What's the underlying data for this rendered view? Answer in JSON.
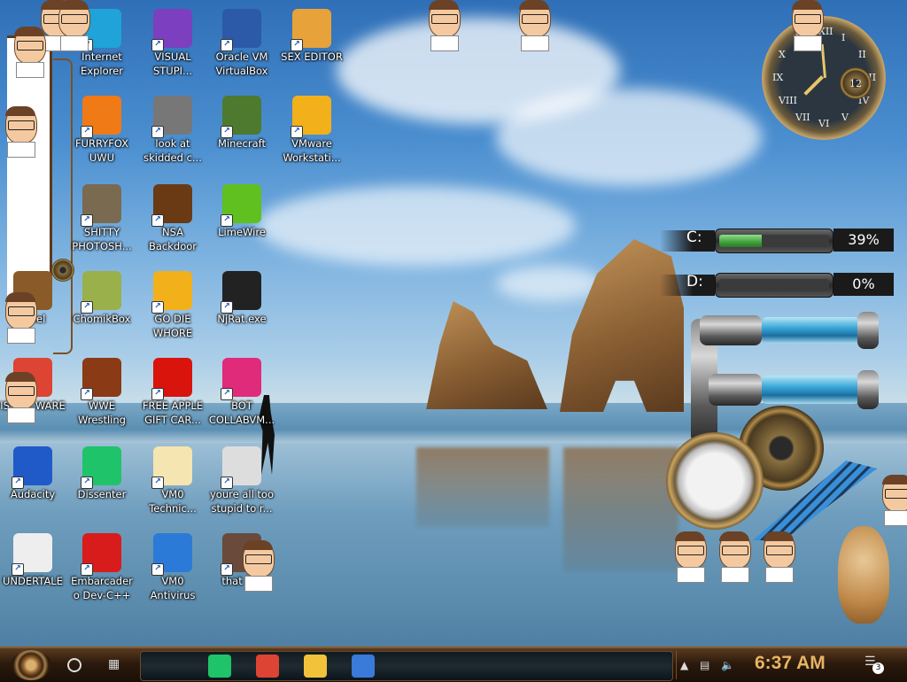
{
  "desktop": {
    "icons": [
      {
        "label": "Internet Explorer",
        "icon": "edge-icon",
        "color": "#1fa3d8"
      },
      {
        "label": "VISUAL STUPI...",
        "icon": "visual-studio-icon",
        "color": "#7b3fbf"
      },
      {
        "label": "Oracle VM VirtualBox",
        "icon": "virtualbox-icon",
        "color": "#2c5aa8"
      },
      {
        "label": "SEX EDITOR",
        "icon": "hex-editor-icon",
        "color": "#e8a23a"
      },
      {
        "label": "FURRYFOX UWU",
        "icon": "firefox-icon",
        "color": "#f07a16"
      },
      {
        "label": "look at skidded c...",
        "icon": "windows-stack-icon",
        "color": "#777777"
      },
      {
        "label": "Minecraft",
        "icon": "minecraft-icon",
        "color": "#4d7a2e"
      },
      {
        "label": "VMware Workstati...",
        "icon": "vmware-icon",
        "color": "#f2b01b"
      },
      {
        "label": "SHITTY PHOTOSH...",
        "icon": "gimp-icon",
        "color": "#7a6a50"
      },
      {
        "label": "NSA Backdoor",
        "icon": "nsa-backdoor-icon",
        "color": "#6a3a14"
      },
      {
        "label": "LimeWire",
        "icon": "limewire-icon",
        "color": "#5fc01f"
      },
      {
        "label": "ChomikBox",
        "icon": "chomikbox-icon",
        "color": "#9ab04a"
      },
      {
        "label": "GO DIE WHORE",
        "icon": "die-icon",
        "color": "#f2b01b"
      },
      {
        "label": "NjRat.exe",
        "icon": "skull-icon",
        "color": "#222222"
      },
      {
        "label": "WWE Wrestling",
        "icon": "wwe-icon",
        "color": "#8a3a14"
      },
      {
        "label": "FREE APPLE GIFT CAR...",
        "icon": "apple-icon",
        "color": "#d8140c"
      },
      {
        "label": "BOT COLLABVM...",
        "icon": "monitor-icon",
        "color": "#e02a7a"
      },
      {
        "label": "Audacity",
        "icon": "audacity-icon",
        "color": "#1f5ac8"
      },
      {
        "label": "Dissenter",
        "icon": "dissenter-icon",
        "color": "#1fc36a"
      },
      {
        "label": "VM0 Technic...",
        "icon": "technician-icon",
        "color": "#f5e5b0"
      },
      {
        "label": "youre all too stupid to r...",
        "icon": "portrait-icon",
        "color": "#dddddd"
      },
      {
        "label": "UNDERTALE",
        "icon": "unity-icon",
        "color": "#eeeeee"
      },
      {
        "label": "Embarcadero Dev-C++",
        "icon": "devcpp-icon",
        "color": "#d81c1c"
      },
      {
        "label": "VM0 Antivirus",
        "icon": "shield-icon",
        "color": "#2c7ad8"
      },
      {
        "label": "that b...",
        "icon": "painting-icon",
        "color": "#6a4a3a"
      },
      {
        "label": "IS IS ...WARE",
        "icon": "chrome-icon",
        "color": "#dd4433"
      },
      {
        "label": "...nel",
        "icon": "gear-panel-icon",
        "color": "#8a5a28"
      }
    ]
  },
  "clock": {
    "numerals": [
      "XII",
      "I",
      "II",
      "III",
      "IV",
      "V",
      "VI",
      "VII",
      "VIII",
      "IX",
      "X",
      "XI"
    ],
    "subdial": "12"
  },
  "drives": [
    {
      "letter": "C:",
      "percent_text": "39%",
      "fill": 0.39
    },
    {
      "letter": "D:",
      "percent_text": "0%",
      "fill": 0.0
    }
  ],
  "taskbar": {
    "apps": [
      {
        "name": "dissenter-taskbar-icon",
        "color": "#1fc36a"
      },
      {
        "name": "chrome-taskbar-icon",
        "color": "#dd4433"
      },
      {
        "name": "file-explorer-taskbar-icon",
        "color": "#f2c23a"
      },
      {
        "name": "network-app-taskbar-icon",
        "color": "#3a7ad8"
      }
    ],
    "time": "6:37 AM",
    "notification_count": "3"
  }
}
